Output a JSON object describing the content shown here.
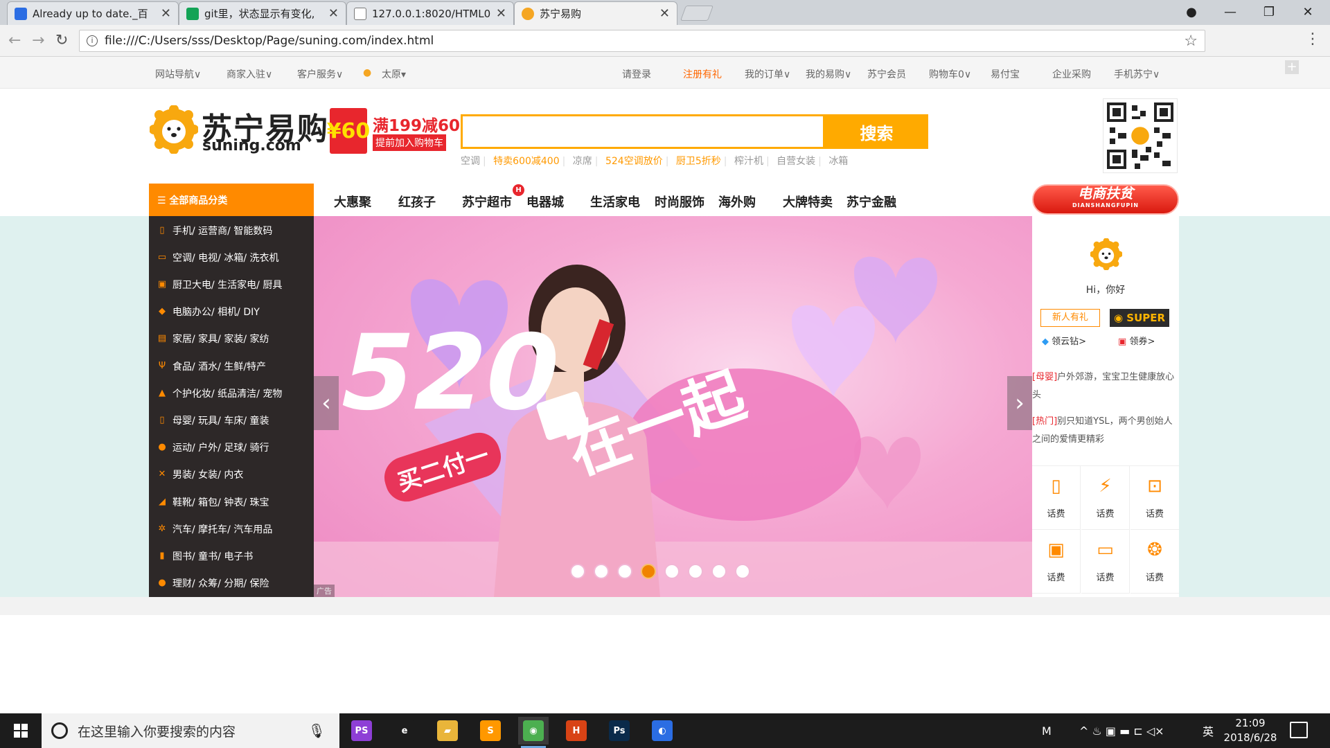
{
  "browser": {
    "tabs": [
      {
        "title": "Already up to date._百",
        "icon_color": "#2b6de3"
      },
      {
        "title": "git里，状态显示有变化,",
        "icon_color": "#13a356"
      },
      {
        "title": "127.0.0.1:8020/HTML0",
        "icon_color": "#888888"
      },
      {
        "title": "苏宁易购",
        "icon_color": "#f5a623"
      }
    ],
    "url": "file:///C:/Users/sss/Desktop/Page/suning.com/index.html",
    "icons": {
      "back": "back-arrow-icon",
      "forward": "forward-arrow-icon",
      "reload": "reload-icon",
      "star": "bookmark-star-icon",
      "menu": "kebab-menu-icon",
      "profile": "profile-icon"
    }
  },
  "site_topbar": {
    "left": [
      "网站导航∨",
      "商家入驻∨",
      "客户服务∨"
    ],
    "location": "太原▾",
    "right": [
      "请登录",
      "注册有礼",
      "我的订单∨",
      "我的易购∨",
      "苏宁会员",
      "购物车0∨",
      "易付宝",
      "企业采购",
      "手机苏宁∨"
    ]
  },
  "header": {
    "logo_cn": "苏宁易购",
    "logo_en": "suning.com",
    "promo_coin": "¥60",
    "promo_line1": "满199减60",
    "promo_line2": "提前加入购物车",
    "search_button": "搜索",
    "search_placeholder": "",
    "hotwords": [
      "空调",
      "特卖600减400",
      "凉席",
      "524空调放价",
      "厨卫5折秒",
      "榨汁机",
      "自营女装",
      "冰箱"
    ]
  },
  "mainnav": {
    "category_head": "☰ 全部商品分类",
    "items": [
      "大惠聚",
      "红孩子",
      "苏宁超市",
      "电器城",
      "生活家电",
      "时尚服饰",
      "海外购",
      "大牌特卖",
      "苏宁金融"
    ],
    "hot_badge": "H",
    "fupin_label": "电商扶贫",
    "fupin_sub": "DIANSHANGFUPIN"
  },
  "categories": [
    {
      "label": "手机/ 运营商/ 智能数码",
      "icon": "▯"
    },
    {
      "label": "空调/ 电视/ 冰箱/ 洗衣机",
      "icon": "▭"
    },
    {
      "label": "厨卫大电/ 生活家电/ 厨具",
      "icon": "▣"
    },
    {
      "label": "电脑办公/ 相机/ DIY",
      "icon": "◆"
    },
    {
      "label": "家居/ 家具/ 家装/ 家纺",
      "icon": "▤"
    },
    {
      "label": "食品/ 酒水/ 生鲜/特产",
      "icon": "Ψ"
    },
    {
      "label": "个护化妆/ 纸品清洁/ 宠物",
      "icon": "▲"
    },
    {
      "label": "母婴/ 玩具/ 车床/ 童装",
      "icon": "▯"
    },
    {
      "label": "运动/ 户外/ 足球/ 骑行",
      "icon": "●"
    },
    {
      "label": "男装/ 女装/ 内衣",
      "icon": "✕"
    },
    {
      "label": "鞋靴/ 箱包/ 钟表/ 珠宝",
      "icon": "◢"
    },
    {
      "label": "汽车/ 摩托车/ 汽车用品",
      "icon": "✲"
    },
    {
      "label": "图书/ 童书/ 电子书",
      "icon": "▮"
    },
    {
      "label": "理财/ 众筹/ 分期/ 保险",
      "icon": "●"
    }
  ],
  "banner": {
    "big_text": "520",
    "tag_text": "买二付一",
    "slogan": "在一起",
    "ad_label": "广告",
    "prev": "‹",
    "next": "›",
    "slide_count": 8,
    "active_slide": 4
  },
  "userpanel": {
    "greeting": "Hi，你好",
    "new_user_btn": "新人有礼",
    "super_btn": "SUPER",
    "super_prefix": "◉",
    "perk1": "领云钻>",
    "perk2": "领券>",
    "news": [
      {
        "tag": "[母婴]",
        "text": "户外郊游，宝宝卫生健康放心头"
      },
      {
        "tag": "[热门]",
        "text": "别只知道YSL，两个男创始人之间的爱情更精彩"
      }
    ],
    "services": [
      {
        "label": "话费",
        "icon": "▯"
      },
      {
        "label": "话费",
        "icon": "⚡"
      },
      {
        "label": "话费",
        "icon": "⊡"
      },
      {
        "label": "话费",
        "icon": "▣"
      },
      {
        "label": "话费",
        "icon": "▭"
      },
      {
        "label": "话费",
        "icon": "❂"
      }
    ]
  },
  "taskbar": {
    "search_placeholder": "在这里输入你要搜索的内容",
    "apps": [
      {
        "name": "phpstorm",
        "text": "PS",
        "bg": "#8e3fd6",
        "running": false
      },
      {
        "name": "edge",
        "text": "e",
        "bg": "#1c1c1c",
        "running": false
      },
      {
        "name": "file-explorer",
        "text": "▰",
        "bg": "#e9b53a",
        "running": false
      },
      {
        "name": "sublime",
        "text": "S",
        "bg": "#ff9800",
        "running": false
      },
      {
        "name": "chrome",
        "text": "◉",
        "bg": "#4caf50",
        "running": true
      },
      {
        "name": "hbuilder",
        "text": "H",
        "bg": "#d84315",
        "running": false
      },
      {
        "name": "photoshop",
        "text": "Ps",
        "bg": "#0a2a4a",
        "running": false
      },
      {
        "name": "browser",
        "text": "◐",
        "bg": "#2b6de3",
        "running": false
      }
    ],
    "tray_ime_m": "M",
    "tray_icons": "^ ♨ ▣ ▬ ⊏ ◁×",
    "tray_lang": "英",
    "time": "21:09",
    "date": "2018/6/28"
  }
}
